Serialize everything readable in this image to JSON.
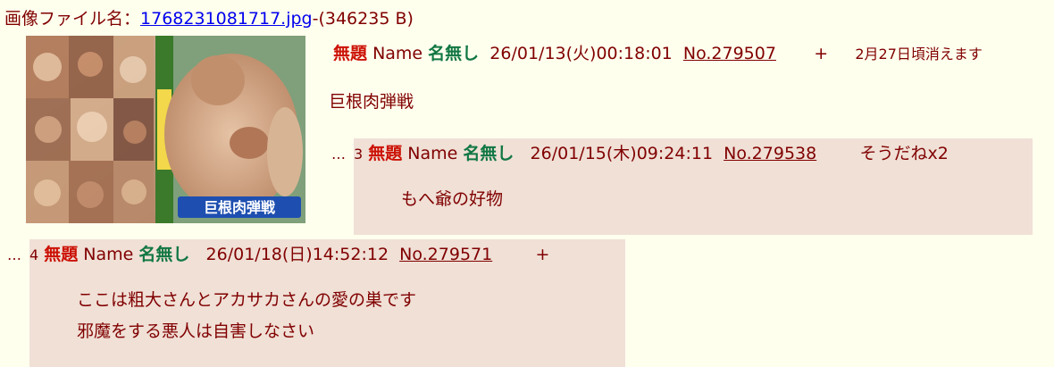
{
  "file": {
    "label": "画像ファイル名：",
    "filename": "1768231081717.jpg",
    "size": "-(346235 B)"
  },
  "op": {
    "subject": "無題",
    "name_label": "Name",
    "name": "名無し",
    "datetime": "26/01/13(火)00:18:01",
    "number": "No.279507",
    "plus": "+",
    "expiry": "2月27日頃消えます",
    "body": "巨根肉弾戦"
  },
  "thumbnail": {
    "cover_text": "巨根肉弾戦"
  },
  "replies": [
    {
      "dots": "…",
      "index": "3",
      "subject": "無題",
      "name_label": "Name",
      "name": "名無し",
      "datetime": "26/01/15(木)09:24:11",
      "number": "No.279538",
      "extra": "そうだねx2",
      "lines": [
        "もへ爺の好物"
      ]
    },
    {
      "dots": "…",
      "index": "4",
      "subject": "無題",
      "name_label": "Name",
      "name": "名無し",
      "datetime": "26/01/18(日)14:52:12",
      "number": "No.279571",
      "extra": "+",
      "lines": [
        "ここは粗大さんとアカサカさんの愛の巣です",
        "邪魔をする悪人は自害しなさい"
      ]
    }
  ],
  "colors": {
    "background": "#FFFFEE",
    "reply_bg": "#F0E0D6",
    "subject": "#CC1105",
    "name": "#117743",
    "text": "#800000",
    "link": "#0000EE"
  }
}
